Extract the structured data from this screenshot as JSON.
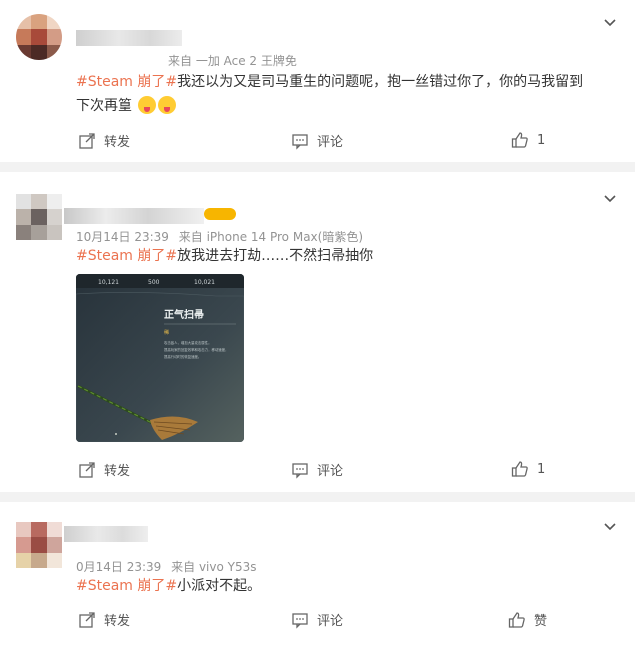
{
  "posts": [
    {
      "meta": {
        "via": "来自 一加 Ace 2 王牌免"
      },
      "tag": "#Steam 崩了#",
      "text": "我还以为又是司马重生的问题呢，抱一丝错过你了，你的马我留到下次再篁",
      "actions": {
        "repost": "转发",
        "comment": "评论",
        "like": "1"
      }
    },
    {
      "meta": {
        "time": "10月14日 23:39",
        "via": "来自 iPhone 14 Pro Max(暗紫色)"
      },
      "tag": "#Steam 崩了#",
      "text": "放我进去打劫……不然扫帚抽你",
      "image": {
        "title": "正气扫帚",
        "small_label": "稀",
        "lines": [
          "攻击敌人，增加大量攻击属性。",
          "提高玩家的回复效率和攻击力，移动速度，",
          "提高行动时的恢复速度。"
        ],
        "status_values": [
          "10,121",
          "500",
          "10,021"
        ]
      },
      "actions": {
        "repost": "转发",
        "comment": "评论",
        "like": "1"
      }
    },
    {
      "meta": {
        "time": "0月14日 23:39",
        "via": "来自 vivo Y53s"
      },
      "tag": "#Steam 崩了#",
      "text": "小派对不起。",
      "actions": {
        "repost": "转发",
        "comment": "评论",
        "like": "赞"
      }
    }
  ],
  "colors": {
    "tag": "#eb7350",
    "meta": "#939393",
    "badge": "#f7b500"
  }
}
